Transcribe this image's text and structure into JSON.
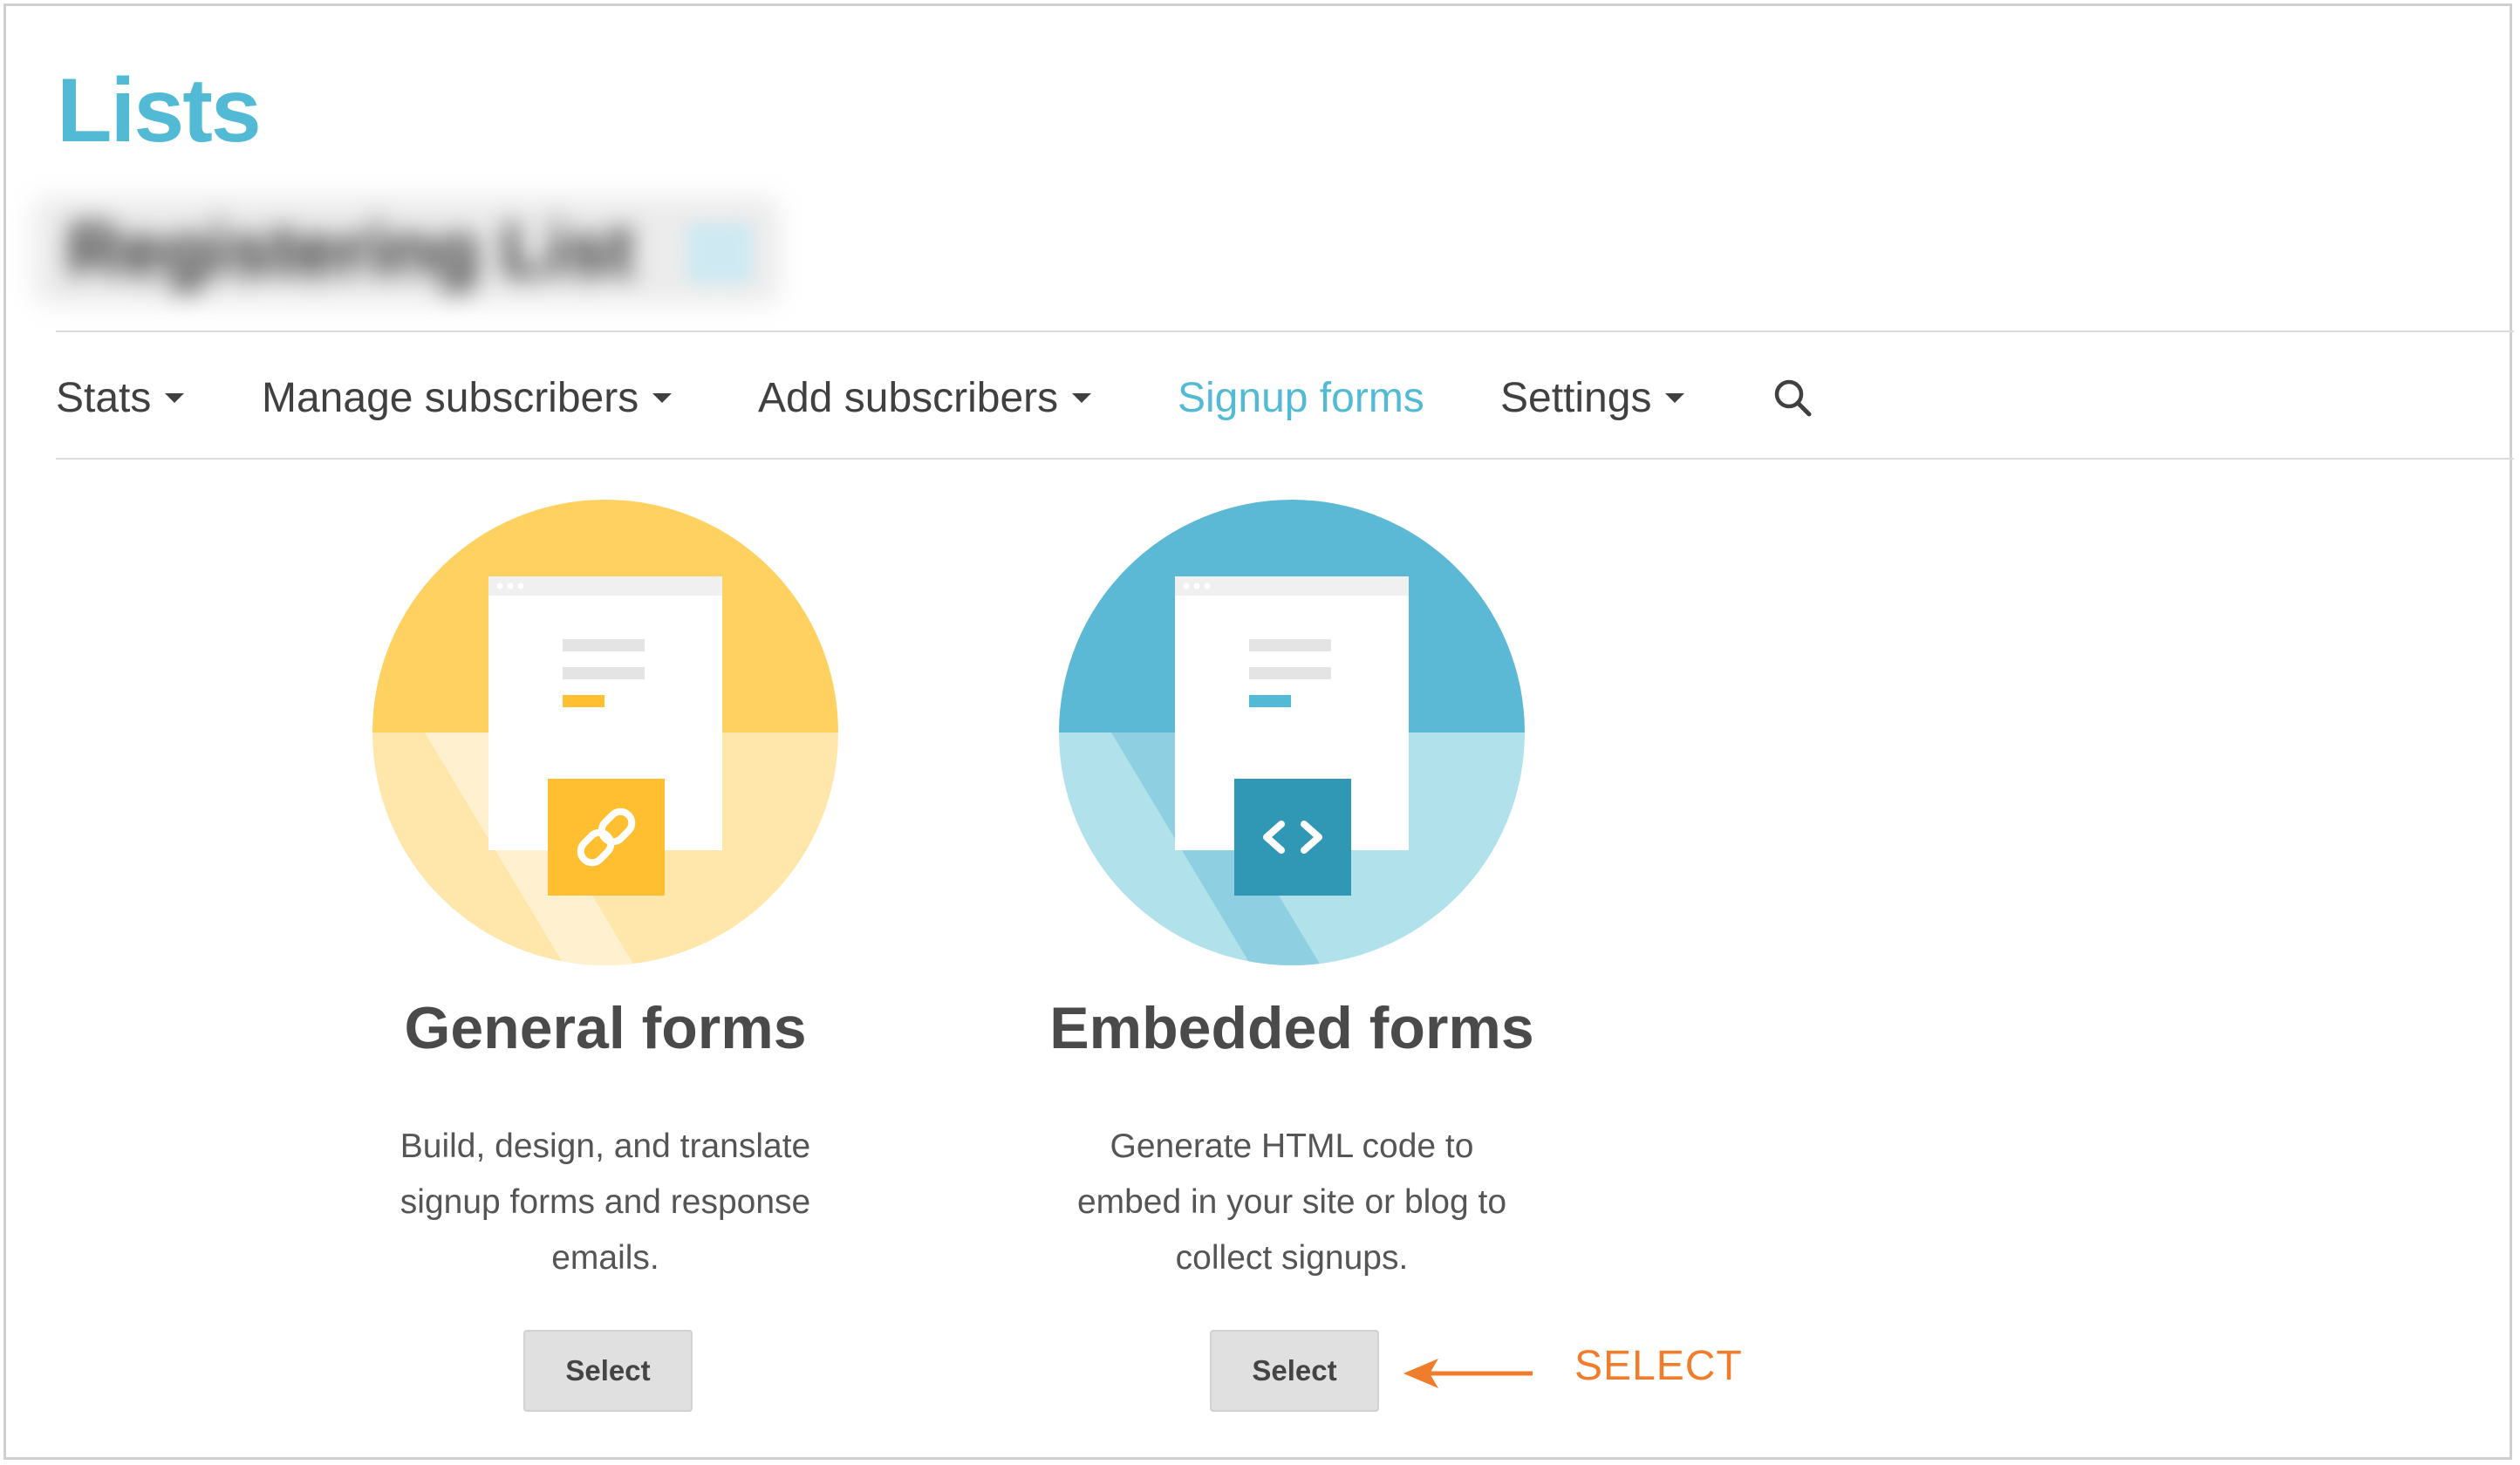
{
  "page": {
    "title": "Lists",
    "list_name": "Registering List"
  },
  "nav": {
    "items": [
      {
        "label": "Stats",
        "has_dropdown": true
      },
      {
        "label": "Manage subscribers",
        "has_dropdown": true
      },
      {
        "label": "Add subscribers",
        "has_dropdown": true
      },
      {
        "label": "Signup forms",
        "has_dropdown": false,
        "active": true
      },
      {
        "label": "Settings",
        "has_dropdown": true
      }
    ],
    "search_icon": "search-icon"
  },
  "cards": [
    {
      "title": "General forms",
      "description": "Build, design, and translate signup forms and response emails.",
      "button_label": "Select",
      "icon": "link-icon",
      "color": "#ffd160",
      "color_light": "#ffe6ab",
      "color_dark": "#ffbf30"
    },
    {
      "title": "Embedded forms",
      "description": "Generate HTML code to embed in your site or blog to collect signups.",
      "button_label": "Select",
      "icon": "code-icon",
      "color": "#5cb9d5",
      "color_light": "#b1e2ec",
      "color_dark": "#3098b5"
    }
  ],
  "annotation": {
    "label": "SELECT",
    "color": "#f07d2b"
  },
  "colors": {
    "accent": "#52bad5",
    "text": "#404040"
  }
}
